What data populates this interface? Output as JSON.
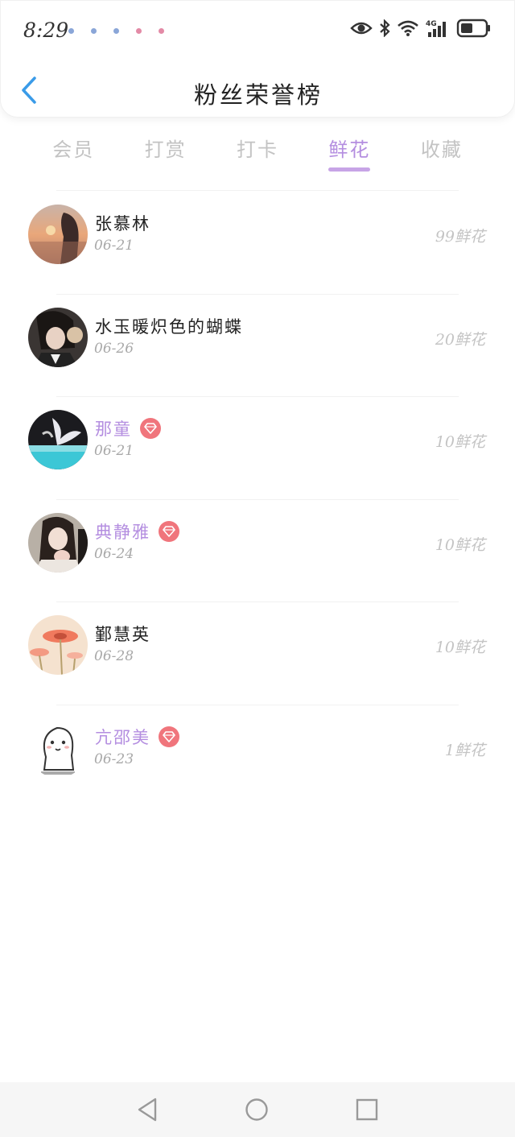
{
  "status_bar": {
    "time": "8:29",
    "notification_dot_colors": [
      "#8aa6d8",
      "#8aa6d8",
      "#8aa6d8",
      "#e38aa6",
      "#e38aa6"
    ],
    "icons": [
      "eye-icon",
      "bluetooth-icon",
      "wifi-icon",
      "signal-4g-icon",
      "battery-icon"
    ]
  },
  "header": {
    "title": "粉丝荣誉榜",
    "back_icon": "chevron-left-icon"
  },
  "tabs": [
    {
      "label": "会员",
      "active": false
    },
    {
      "label": "打赏",
      "active": false
    },
    {
      "label": "打卡",
      "active": false
    },
    {
      "label": "鲜花",
      "active": true
    },
    {
      "label": "收藏",
      "active": false
    }
  ],
  "fans": [
    {
      "name": "张慕林",
      "date": "06-21",
      "amount": "99鲜花",
      "vip": false
    },
    {
      "name": "水玉暖炽色的蝴蝶",
      "date": "06-26",
      "amount": "20鲜花",
      "vip": false
    },
    {
      "name": "那童",
      "date": "06-21",
      "amount": "10鲜花",
      "vip": true
    },
    {
      "name": "典静雅",
      "date": "06-24",
      "amount": "10鲜花",
      "vip": true
    },
    {
      "name": "鄞慧英",
      "date": "06-28",
      "amount": "10鲜花",
      "vip": false
    },
    {
      "name": "亢邵美",
      "date": "06-23",
      "amount": "1鲜花",
      "vip": true
    }
  ],
  "colors": {
    "accent": "#b48ee0",
    "back_arrow": "#3a9be8",
    "vip_badge": "#f0757c"
  },
  "navbar": {
    "icons": [
      "back-triangle-icon",
      "home-circle-icon",
      "recents-square-icon"
    ]
  }
}
